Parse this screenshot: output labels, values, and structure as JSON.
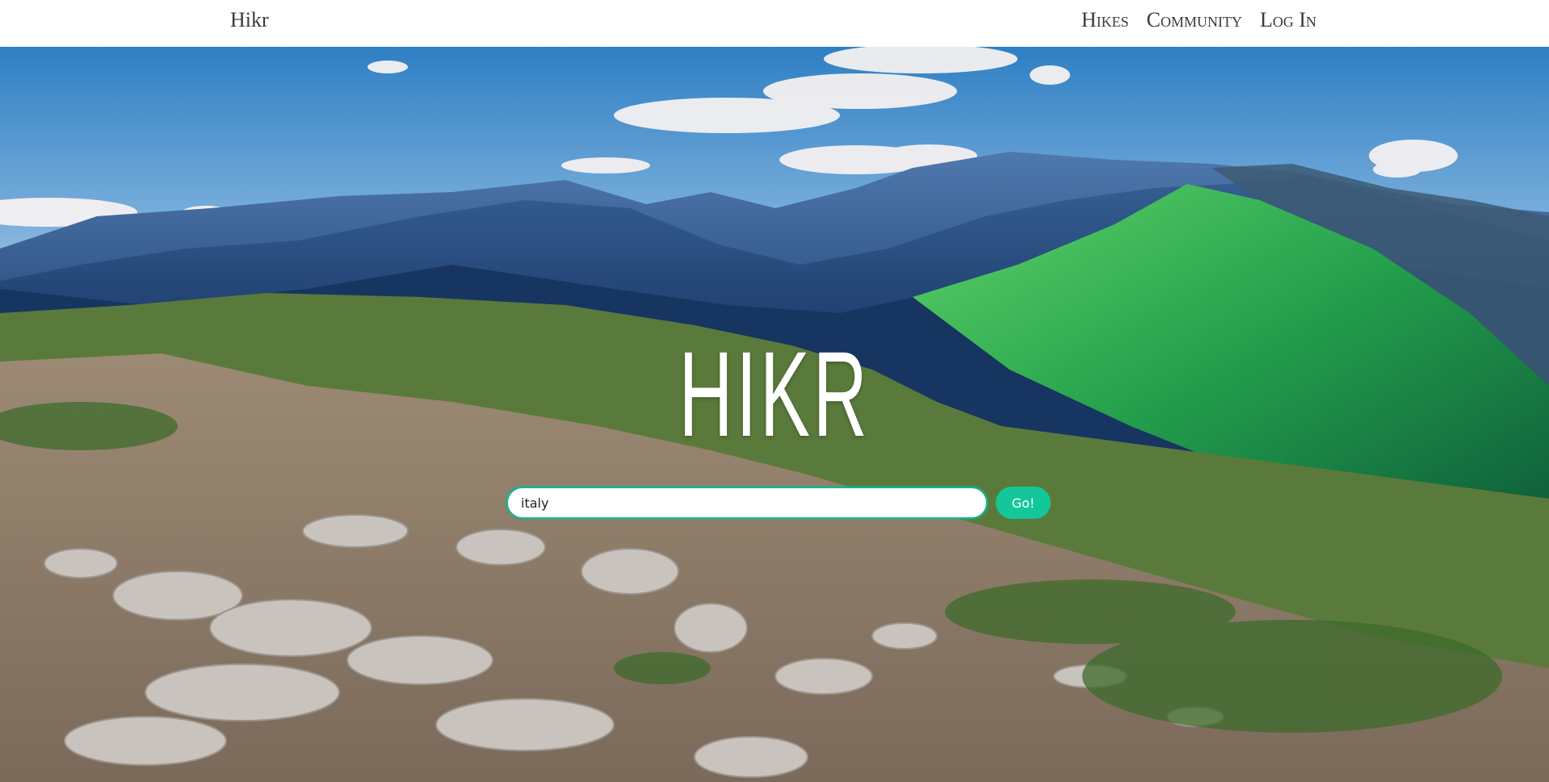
{
  "nav": {
    "brand": "Hikr",
    "links": [
      {
        "label": "Hikes"
      },
      {
        "label": "Community"
      },
      {
        "label": "Log In"
      }
    ]
  },
  "hero": {
    "title": "HIKR",
    "search": {
      "value": "italy",
      "placeholder": ""
    },
    "go_label": "Go!"
  },
  "colors": {
    "accent": "#14c79a",
    "accent_border": "#14b78d",
    "sky": "#3f86c9",
    "grass": "#2f9a49"
  }
}
